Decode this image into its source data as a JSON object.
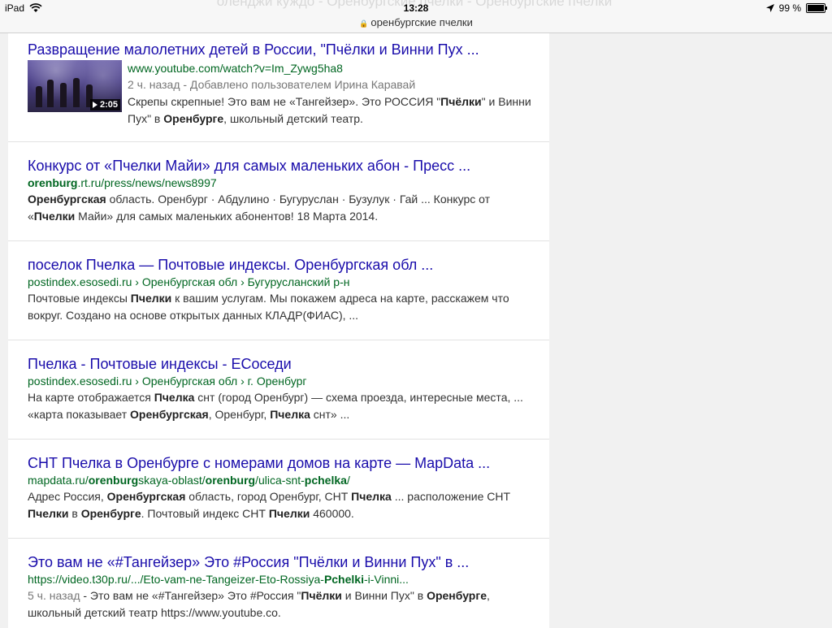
{
  "statusbar": {
    "device": "iPad",
    "time": "13:28",
    "battery_label": "99 %",
    "battery_level": 0.99,
    "url": "оренбургские пчелки",
    "ghost_title": "оленджи куждо - Оренбургские пчелки - Оренбургские пчелки"
  },
  "results": [
    {
      "title": "Развращение малолетних детей в России, \"Пчёлки и Винни Пух ...",
      "url": "www.youtube.com/watch?v=Im_Zywg5ha8",
      "meta": "2 ч. назад - Добавлено пользователем Ирина Каравай",
      "video_duration": "2:05",
      "snippet_parts": [
        "Скрепы скрепные! Это вам не «Тангейзер». Это РОССИЯ \"",
        "Пчёлки",
        "\" и Винни Пух\" в ",
        "Оренбурге",
        ", школьный детский театр."
      ]
    },
    {
      "title": "Конкурс от «Пчелки Майи» для самых маленьких абон - Пресс ...",
      "url_parts": [
        "orenburg",
        ".rt.ru/press/news/news8997"
      ],
      "snippet_parts": [
        "Оренбургская",
        " область. Оренбург · Абдулино · Бугуруслан · Бузулук · Гай ... Конкурс от «",
        "Пчелки",
        " Майи» для самых маленьких абонентов! 18 Марта 2014."
      ]
    },
    {
      "title": "поселок Пчелка — Почтовые индексы. Оренбургская обл ...",
      "url": "postindex.esosedi.ru › Оренбургская обл › Бугурусланский р-н",
      "snippet_parts": [
        "Почтовые индексы ",
        "Пчелки",
        " к вашим услугам. Мы покажем адреса на карте, расскажем что вокруг. Создано на основе открытых данных КЛАДР(ФИАС), ..."
      ]
    },
    {
      "title": "Пчелка - Почтовые индексы - ЕСоседи",
      "url": "postindex.esosedi.ru › Оренбургская обл › г. Оренбург",
      "snippet_parts": [
        "На карте отображается ",
        "Пчелка",
        " снт (город Оренбург) — схема проезда, интересные места, ... «карта показывает ",
        "Оренбургская",
        ", Оренбург, ",
        "Пчелка",
        " снт» ..."
      ]
    },
    {
      "title": "СНТ Пчелка в Оренбурге с номерами домов на карте — MapData ...",
      "url_parts": [
        "mapdata.ru/",
        "orenburg",
        "skaya-oblast/",
        "orenburg",
        "/ulica-snt-",
        "pchelka",
        "/"
      ],
      "snippet_parts": [
        "Адрес Россия, ",
        "Оренбургская",
        " область, город Оренбург, СНТ ",
        "Пчелка",
        " ... расположение СНТ ",
        "Пчелки",
        " в ",
        "Оренбурге",
        ". Почтовый индекс СНТ ",
        "Пчелки",
        " 460000."
      ]
    },
    {
      "title": "Это вам не «#Тангейзер» Это #Россия \"Пчёлки и Винни Пух\" в ...",
      "url_parts": [
        "https://video.t30p.ru/.../Eto-vam-ne-Tangeizer-Eto-Rossiya-",
        "Pchelki",
        "-i-Vinni..."
      ],
      "date": "5 ч. назад",
      "snippet_parts": [
        " - Это вам не «#Тангейзер» Это #Россия \"",
        "Пчёлки",
        " и Винни Пух\" в ",
        "Оренбурге",
        ", школьный детский театр https://www.youtube.co."
      ]
    }
  ]
}
